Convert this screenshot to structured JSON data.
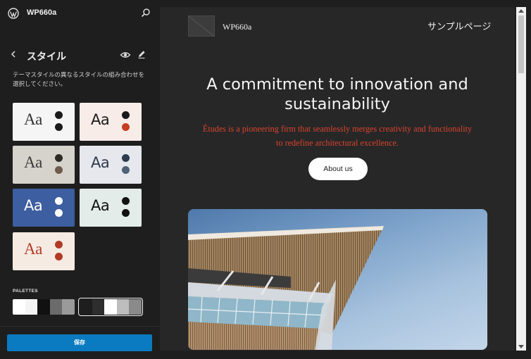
{
  "sidebar": {
    "site_name": "WP660a",
    "panel_title": "スタイル",
    "description": "テーマスタイルの異なるスタイルの組み合わせを選択してください。",
    "palettes_label": "PALETTES",
    "save_label": "保存"
  },
  "style_variations": [
    {
      "label": "Aa",
      "bg": "#f5f5f5",
      "text": "#333333",
      "dot1": "#1a1a1a",
      "dot2": "#1a1a1a"
    },
    {
      "label": "Aa",
      "bg": "#f7ece8",
      "text": "#1a1a1a",
      "dot1": "#1a1a1a",
      "dot2": "#c63d22"
    },
    {
      "label": "Aa",
      "bg": "#d6d2cc",
      "text": "#3a3a3a",
      "dot1": "#2d2a28",
      "dot2": "#6f5a4d"
    },
    {
      "label": "Aa",
      "bg": "#e6e8ee",
      "text": "#2f3b4a",
      "dot1": "#2c3d4f",
      "dot2": "#4e6275"
    },
    {
      "label": "Aa",
      "bg": "#3d5ea0",
      "text": "#ffffff",
      "dot1": "#ffffff",
      "dot2": "#ffffff"
    },
    {
      "label": "Aa",
      "bg": "#e3ece8",
      "text": "#111111",
      "dot1": "#111111",
      "dot2": "#111111"
    },
    {
      "label": "Aa",
      "bg": "#f5ebe2",
      "text": "#b13b26",
      "dot1": "#b13b26",
      "dot2": "#b13b26"
    }
  ],
  "palettes": [
    {
      "selected": false,
      "colors": [
        "#ffffff",
        "#f4f4f4",
        "#111111",
        "#6b6b6b",
        "#9a9a9a"
      ]
    },
    {
      "selected": true,
      "colors": [
        "#1e1e1e",
        "#2e2e2e",
        "#ffffff",
        "#bdbdbd",
        "#8a8a8a"
      ]
    }
  ],
  "preview": {
    "site_title": "WP660a",
    "nav_item": "サンプルページ",
    "hero_title": "A commitment to innovation and sustainability",
    "hero_text": "Études is a pioneering firm that seamlessly merges creativity and functionality to redefine architectural excellence.",
    "cta_label": "About us"
  }
}
